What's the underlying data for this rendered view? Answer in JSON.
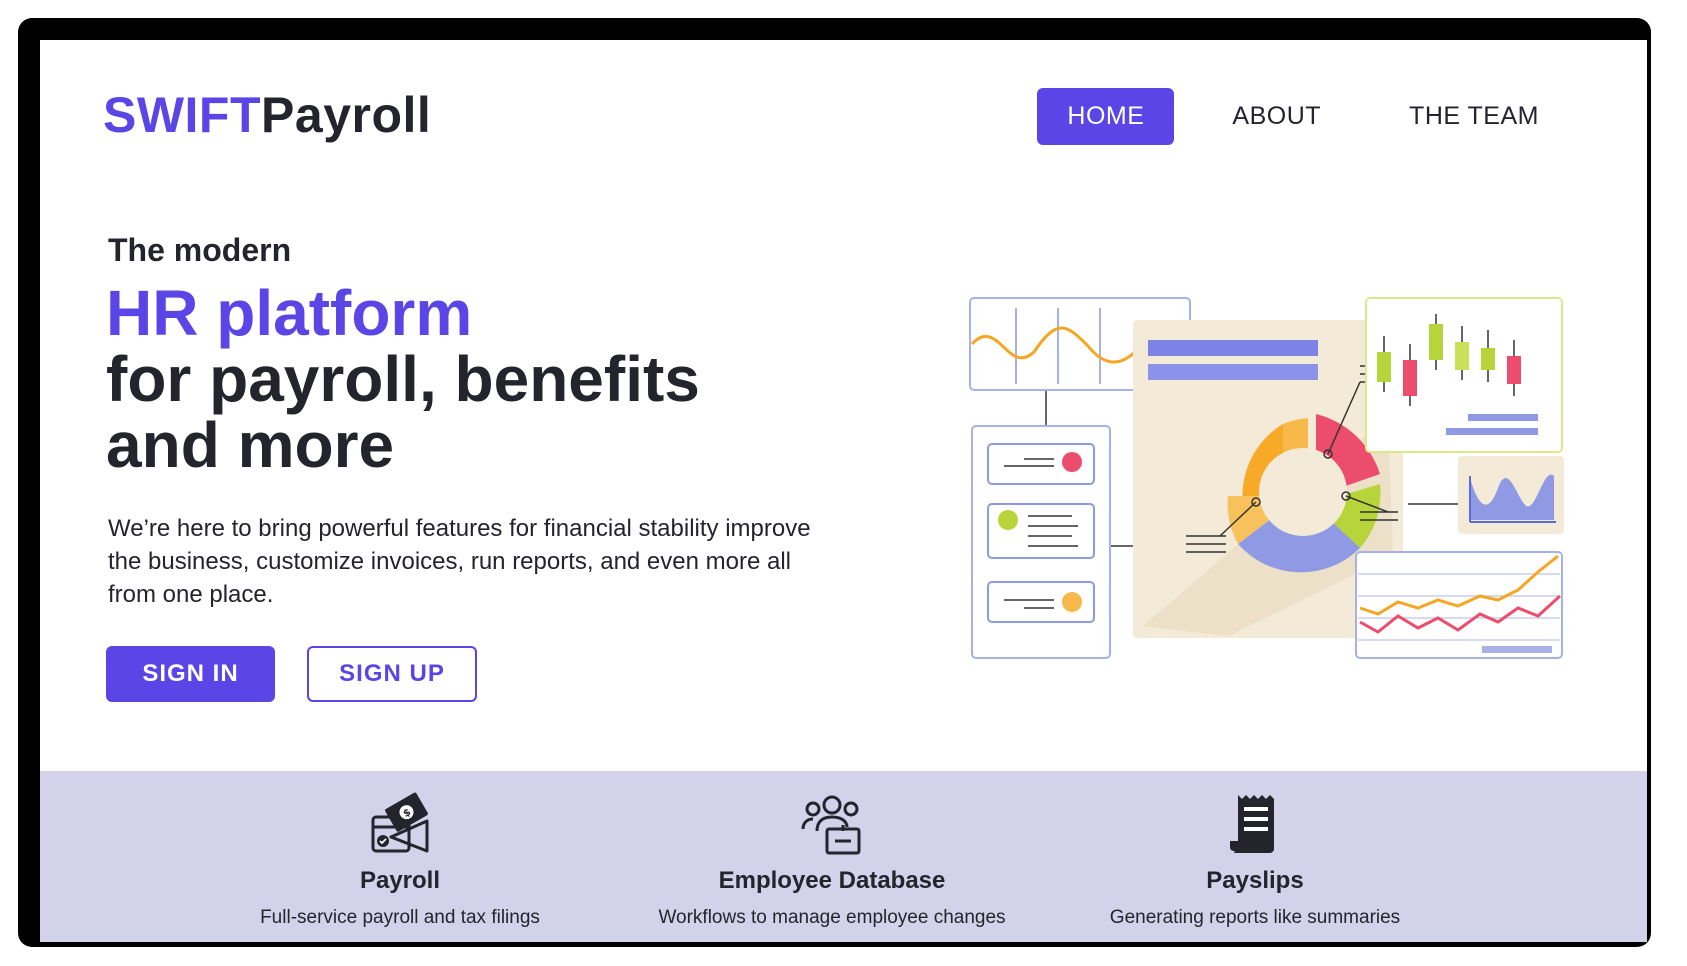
{
  "brand": {
    "part1": "SWIFT",
    "part2": "Payroll",
    "accent_color": "#5b45e6"
  },
  "nav": {
    "items": [
      {
        "label": "HOME",
        "active": true
      },
      {
        "label": "ABOUT",
        "active": false
      },
      {
        "label": "THE TEAM",
        "active": false
      }
    ]
  },
  "hero": {
    "eyebrow": "The modern",
    "headline_accent": "HR platform",
    "headline_line2": "for payroll, benefits",
    "headline_line3": "and more",
    "description": "We’re here to bring powerful features for financial stability improve the business, customize invoices, run reports, and even more all from one place.",
    "signin_label": "SIGN IN",
    "signup_label": "SIGN UP"
  },
  "features": [
    {
      "icon": "payroll-wallet-icon",
      "title": "Payroll",
      "description": "Full-service payroll and tax filings"
    },
    {
      "icon": "employee-database-icon",
      "title": "Employee Database",
      "description": "Workflows to manage employee changes"
    },
    {
      "icon": "payslip-receipt-icon",
      "title": "Payslips",
      "description": "Generating reports like summaries"
    }
  ]
}
